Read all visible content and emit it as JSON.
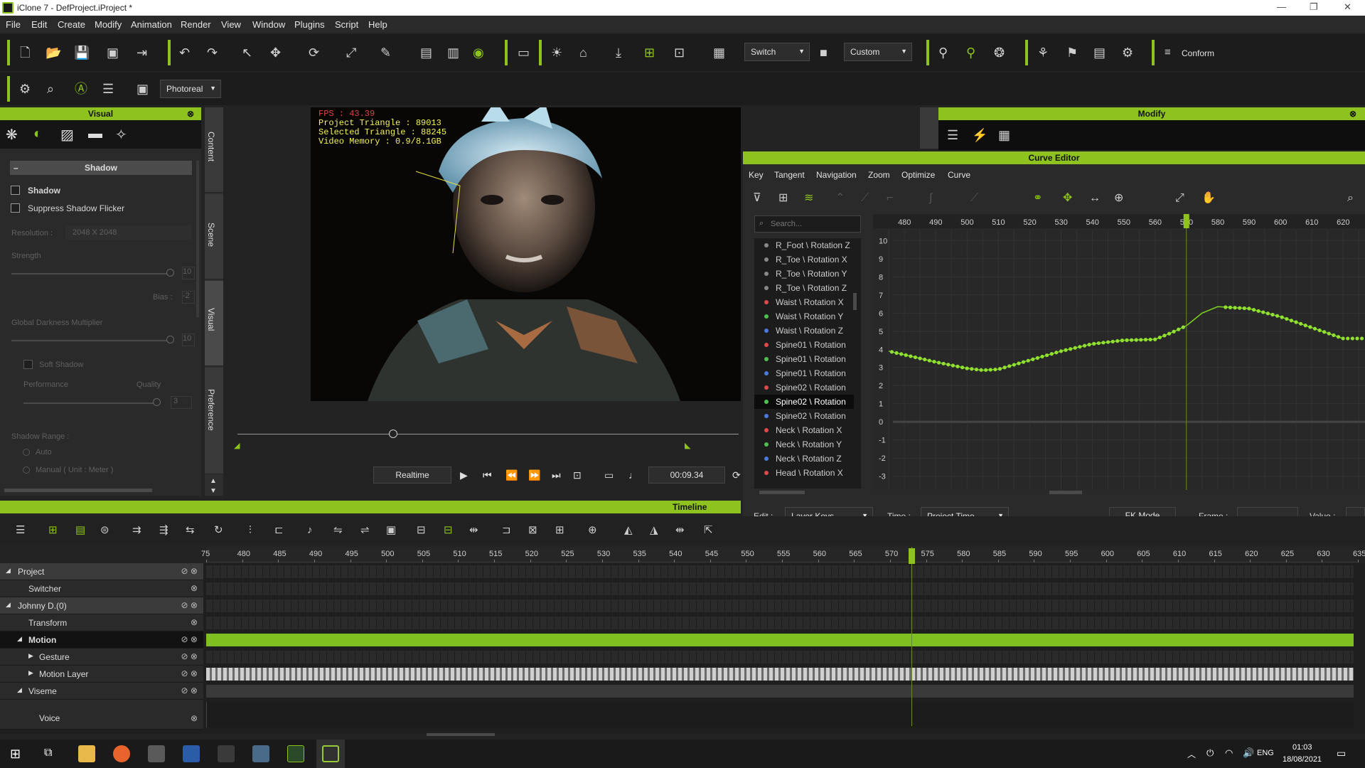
{
  "window": {
    "title": "iClone 7 - DefProject.iProject *"
  },
  "menu": [
    "File",
    "Edit",
    "Create",
    "Modify",
    "Animation",
    "Render",
    "View",
    "Window",
    "Plugins",
    "Script",
    "Help"
  ],
  "toolbar": {
    "switch_label": "Switch",
    "camera_label": "Custom",
    "conform_label": "Conform",
    "render_label": "Photoreal"
  },
  "visual_panel": {
    "title": "Visual",
    "section": "Shadow",
    "shadow_label": "Shadow",
    "suppress_label": "Suppress Shadow Flicker",
    "resolution_label": "Resolution :",
    "resolution_value": "2048 X 2048",
    "strength_label": "Strength",
    "bias_label": "Bias :",
    "global_darkness_label": "Global Darkness Multiplier",
    "soft_shadow_label": "Soft Shadow",
    "performance_label": "Performance",
    "quality_label": "Quality",
    "range_label": "Shadow Range :",
    "auto_label": "Auto",
    "manual_label": "Manual ( Unit : Meter )",
    "strength_value": "10",
    "bias_value": "-2",
    "darkness_value": "10",
    "quality_value": "3"
  },
  "side_tabs": [
    "Content",
    "Scene",
    "Visual",
    "Preference"
  ],
  "viewport": {
    "fps": "FPS : 43.39",
    "triangles": "Project Triangle : 89013",
    "selected": "Selected Triangle : 88245",
    "memory": "Video Memory : 0.9/8.1GB"
  },
  "playback": {
    "mode": "Realtime",
    "time": "00:09.34"
  },
  "modify": {
    "title": "Modify"
  },
  "curve_editor": {
    "title": "Curve Editor",
    "menu": [
      "Key",
      "Tangent",
      "Navigation",
      "Zoom",
      "Optimize",
      "Curve"
    ],
    "search_placeholder": "Search...",
    "channels": [
      {
        "name": "R_Foot \\ Rotation Z",
        "color": "#888888"
      },
      {
        "name": "R_Toe \\ Rotation X",
        "color": "#888888"
      },
      {
        "name": "R_Toe \\ Rotation Y",
        "color": "#888888"
      },
      {
        "name": "R_Toe \\ Rotation Z",
        "color": "#888888"
      },
      {
        "name": "Waist \\ Rotation X",
        "color": "#e04848"
      },
      {
        "name": "Waist \\ Rotation Y",
        "color": "#4cc24c"
      },
      {
        "name": "Waist \\ Rotation Z",
        "color": "#4a7ae0"
      },
      {
        "name": "Spine01 \\ Rotation",
        "color": "#e04848"
      },
      {
        "name": "Spine01 \\ Rotation",
        "color": "#4cc24c"
      },
      {
        "name": "Spine01 \\ Rotation",
        "color": "#4a7ae0"
      },
      {
        "name": "Spine02 \\ Rotation",
        "color": "#e04848"
      },
      {
        "name": "Spine02 \\ Rotation",
        "color": "#4cc24c"
      },
      {
        "name": "Spine02 \\ Rotation",
        "color": "#4a7ae0"
      },
      {
        "name": "Neck \\ Rotation X",
        "color": "#e04848"
      },
      {
        "name": "Neck \\ Rotation Y",
        "color": "#4cc24c"
      },
      {
        "name": "Neck \\ Rotation Z",
        "color": "#4a7ae0"
      },
      {
        "name": "Head \\ Rotation X",
        "color": "#e04848"
      }
    ],
    "selected_index": 11,
    "x_ticks": [
      "480",
      "490",
      "500",
      "510",
      "520",
      "530",
      "540",
      "550",
      "560",
      "570",
      "580",
      "590",
      "600",
      "610",
      "620"
    ],
    "y_ticks": [
      "10",
      "9",
      "8",
      "7",
      "6",
      "5",
      "4",
      "3",
      "2",
      "1",
      "0",
      "-1",
      "-2",
      "-3"
    ],
    "current_frame": 570,
    "curve_frames": [
      475,
      480,
      490,
      500,
      505,
      510,
      520,
      530,
      540,
      550,
      560,
      565,
      570,
      575,
      580,
      590,
      600,
      610,
      620
    ],
    "curve_values": [
      3.9,
      3.7,
      3.3,
      2.95,
      2.85,
      2.9,
      3.4,
      3.9,
      4.3,
      4.5,
      4.55,
      4.9,
      5.3,
      6.0,
      6.35,
      6.25,
      5.8,
      5.2,
      4.6
    ],
    "edit_label": "Edit :",
    "edit_value": "Layer Keys",
    "time_label": "Time :",
    "time_value": "Project Time",
    "fk_label": "FK Mode",
    "frame_label": "Frame :",
    "value_label": "Value :"
  },
  "timeline": {
    "title": "Timeline",
    "ticks": [
      "75",
      "480",
      "485",
      "490",
      "495",
      "500",
      "505",
      "510",
      "515",
      "520",
      "525",
      "530",
      "535",
      "540",
      "545",
      "550",
      "555",
      "560",
      "565",
      "570",
      "575",
      "580",
      "585",
      "590",
      "595",
      "600",
      "605",
      "610",
      "615",
      "620",
      "625",
      "630",
      "635"
    ],
    "tracks": [
      {
        "label": "Project",
        "indent": 0,
        "expand": "◢"
      },
      {
        "label": "Switcher",
        "indent": 1,
        "expand": ""
      },
      {
        "label": "Johnny D.(0)",
        "indent": 0,
        "expand": "◢"
      },
      {
        "label": "Transform",
        "indent": 1,
        "expand": ""
      },
      {
        "label": "Motion",
        "indent": 1,
        "expand": "◢"
      },
      {
        "label": "Gesture",
        "indent": 2,
        "expand": "▶"
      },
      {
        "label": "Motion Layer",
        "indent": 2,
        "expand": "▶"
      },
      {
        "label": "Viseme",
        "indent": 1,
        "expand": "◢"
      },
      {
        "label": "Voice",
        "indent": 2,
        "expand": ""
      }
    ]
  },
  "taskbar": {
    "lang": "ENG",
    "time": "01:03",
    "date": "18/08/2021"
  }
}
